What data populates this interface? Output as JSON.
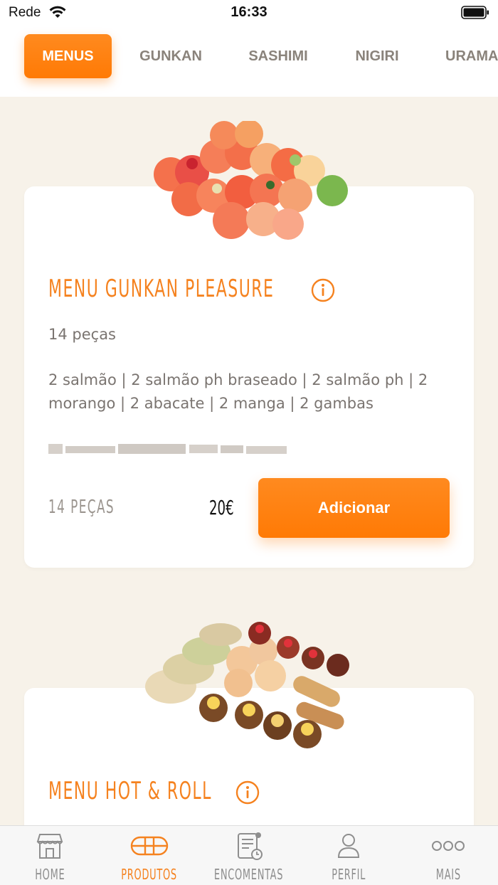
{
  "status": {
    "carrier": "Rede",
    "time": "16:33"
  },
  "categories": [
    {
      "label": "MENUS",
      "active": true
    },
    {
      "label": "GUNKAN",
      "active": false
    },
    {
      "label": "SASHIMI",
      "active": false
    },
    {
      "label": "NIGIRI",
      "active": false
    },
    {
      "label": "URAMA",
      "active": false
    }
  ],
  "products": [
    {
      "title": "MENU GUNKAN PLEASURE",
      "pieces": "14 peças",
      "ingredients": "2 salmão | 2 salmão ph braseado | 2 salmão ph | 2 morango | 2 abacate | 2 manga | 2 gambas",
      "pieces_label": "14 PEÇAS",
      "price": "20€",
      "add_label": "Adicionar"
    },
    {
      "title": "MENU HOT & ROLL"
    }
  ],
  "nav": [
    {
      "label": "HOME",
      "icon": "home-store-icon",
      "active": false
    },
    {
      "label": "PRODUTOS",
      "icon": "sushi-icon",
      "active": true
    },
    {
      "label": "ENCOMENTAS",
      "icon": "orders-icon",
      "active": false
    },
    {
      "label": "PERFIL",
      "icon": "user-icon",
      "active": false
    },
    {
      "label": "MAIS",
      "icon": "more-icon",
      "active": false
    }
  ],
  "colors": {
    "accent": "#f5821f",
    "button": "#ff7a05",
    "background": "#f7f2e9"
  }
}
